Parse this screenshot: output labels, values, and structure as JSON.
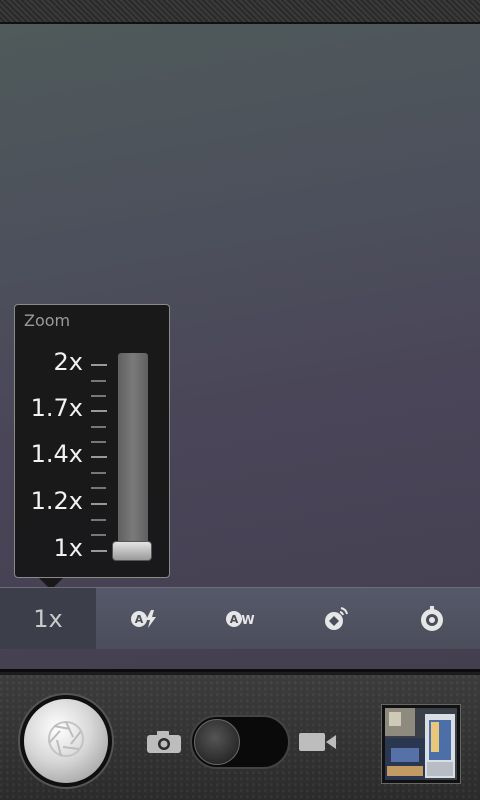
{
  "zoom_popup": {
    "title": "Zoom",
    "levels": [
      "2x",
      "1.7x",
      "1.4x",
      "1.2x",
      "1x"
    ],
    "current_fraction": 0
  },
  "settings_strip": {
    "zoom_value": "1x",
    "icons": [
      "flash-auto-icon",
      "white-balance-auto-icon",
      "scene-mode-icon",
      "settings-icon"
    ]
  },
  "controls": {
    "shutter_icon": "aperture-icon",
    "camera_icon": "camera-icon",
    "video_icon": "video-camera-icon",
    "mode_selected": "camera"
  }
}
